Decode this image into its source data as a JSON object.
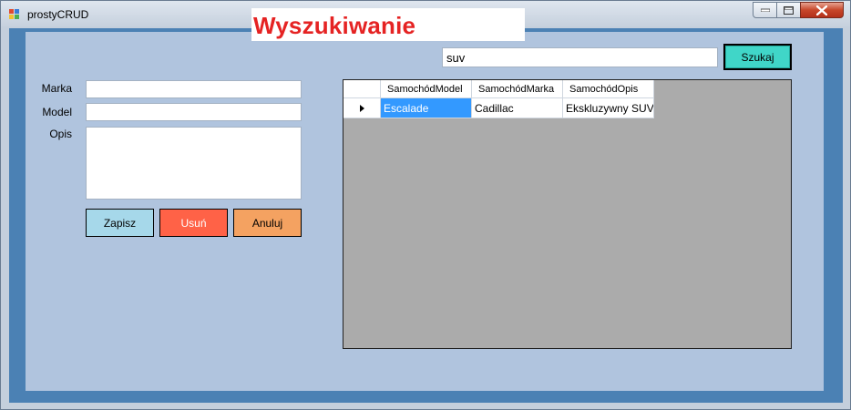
{
  "window": {
    "title": "prostyCRUD",
    "icon": "app-icon",
    "controls": [
      "minimize-icon",
      "maximize-icon",
      "close-icon"
    ]
  },
  "header": {
    "heading": "Wyszukiwanie"
  },
  "search": {
    "value": "suv",
    "button_label": "Szukaj"
  },
  "form": {
    "labels": {
      "marka": "Marka",
      "model": "Model",
      "opis": "Opis"
    },
    "values": {
      "marka": "",
      "model": "",
      "opis": ""
    },
    "buttons": {
      "save": "Zapisz",
      "delete": "Usuń",
      "cancel": "Anuluj"
    }
  },
  "grid": {
    "columns": [
      "SamochódModel",
      "SamochódMarka",
      "SamochódOpis"
    ],
    "rows": [
      {
        "model": "Escalade",
        "marka": "Cadillac",
        "opis": "Ekskluzywny SUV"
      }
    ]
  },
  "colors": {
    "form_background": "#b0c4de",
    "frame": "#4b81b4",
    "heading": "#e52323",
    "search_button": "#40d6c8",
    "save_button": "#a6d8ea",
    "delete_button": "#ff6247",
    "cancel_button": "#f4a261",
    "selection": "#3399ff",
    "grid_background": "#ababab"
  }
}
